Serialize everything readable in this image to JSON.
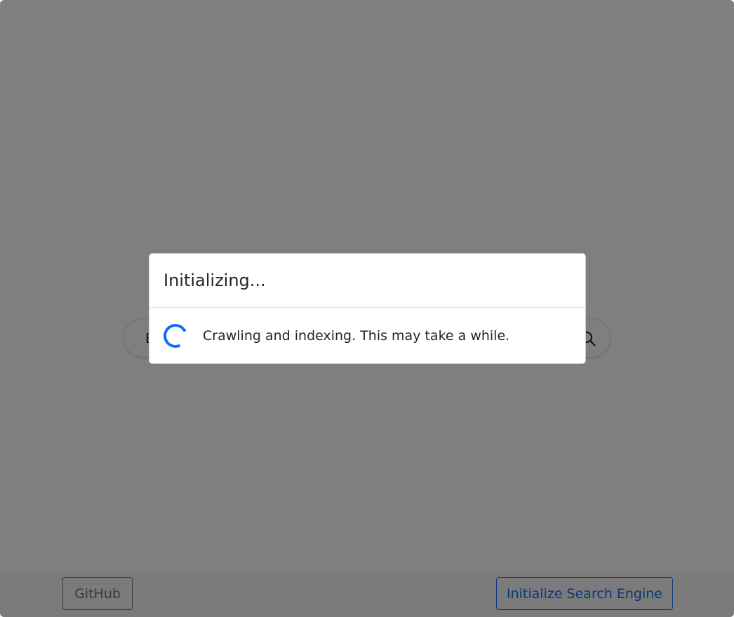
{
  "search": {
    "placeholder": "Enter search query"
  },
  "footer": {
    "github_label": "GitHub",
    "init_label": "Initialize Search Engine"
  },
  "modal": {
    "title": "Initializing...",
    "message": "Crawling and indexing. This may take a while."
  },
  "icons": {
    "search_button": "search-icon",
    "spinner": "loading-spinner-icon"
  },
  "colors": {
    "primary": "#0d6efd",
    "secondary": "#6c757d",
    "backdrop": "rgba(0,0,0,0.5)"
  }
}
